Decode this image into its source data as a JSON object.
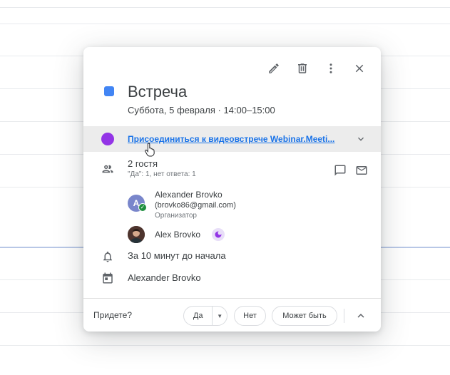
{
  "event": {
    "title": "Встреча",
    "datetime": "Суббота, 5 февраля  ·  14:00–15:00",
    "color": "#4285f4"
  },
  "toolbar": {
    "icons": [
      "pencil-icon",
      "trash-icon",
      "more-vert-icon",
      "close-icon"
    ]
  },
  "meeting": {
    "link_text": "Присоединиться к видеовстрече Webinar.Meeti...",
    "icon_color": "#9334e6"
  },
  "guests": {
    "count_label": "2 гостя",
    "summary": "\"Да\": 1, нет ответа: 1",
    "list": [
      {
        "avatar_letter": "A",
        "name": "Alexander Brovko",
        "email": "(brovko86@gmail.com)",
        "role": "Организатор"
      },
      {
        "name": "Alex Brovko"
      }
    ]
  },
  "reminder": "За 10 минут до начала",
  "calendar_owner": "Alexander Brovko",
  "rsvp": {
    "question": "Придете?",
    "yes": "Да",
    "no": "Нет",
    "maybe": "Может быть"
  }
}
